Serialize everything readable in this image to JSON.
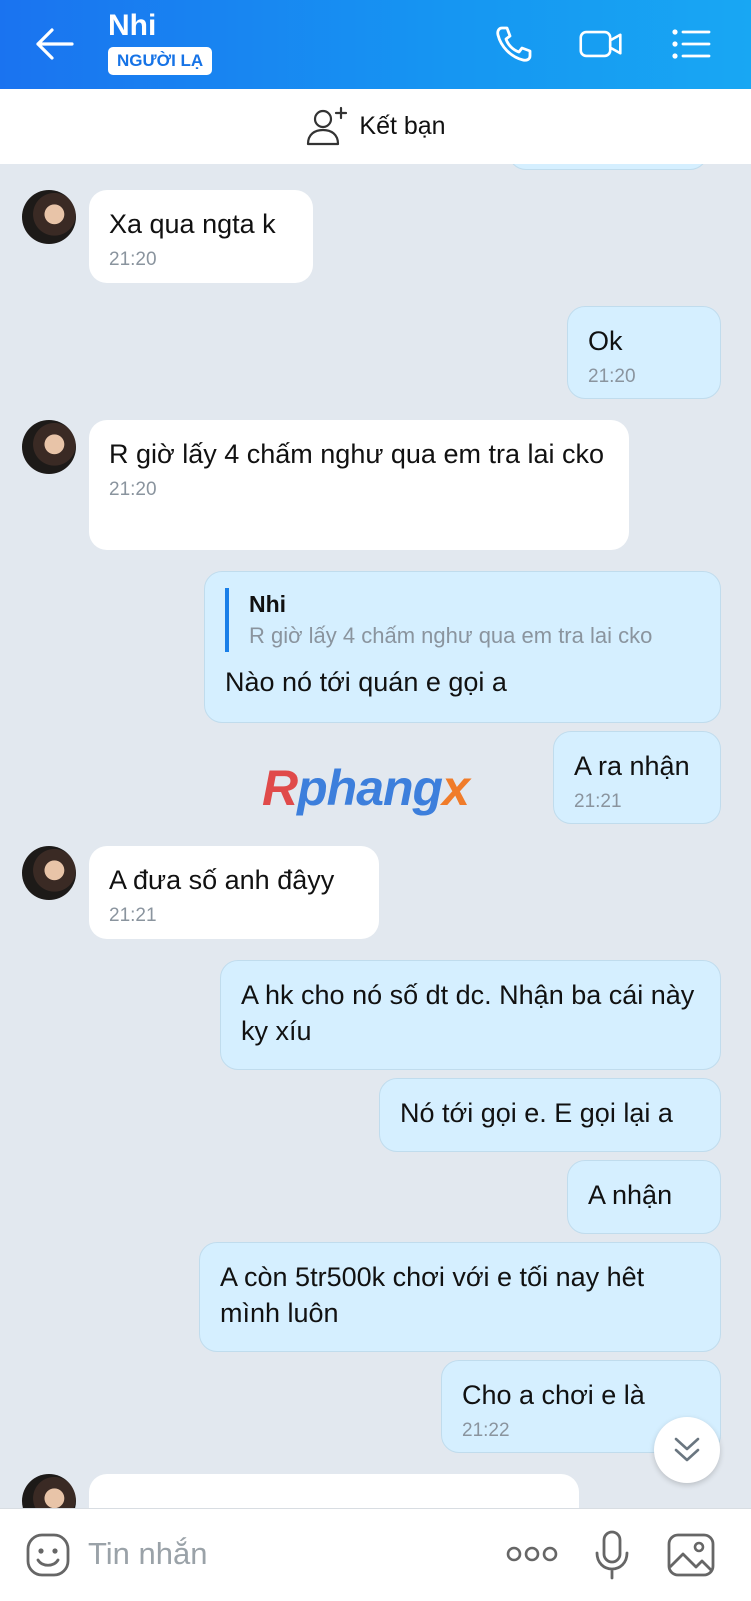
{
  "header": {
    "title": "Nhi",
    "badge": "NGƯỜI LẠ",
    "accent": "#1a73f0"
  },
  "friend_bar": {
    "label": "Kết bạn",
    "icon": "add-friend-icon"
  },
  "messages": [
    {
      "dir": "in",
      "text": "Xa qua ngta k",
      "time": "21:20"
    },
    {
      "dir": "out",
      "text": "Ok",
      "time": "21:20"
    },
    {
      "dir": "in",
      "text": "R giờ lấy 4 chấm nghư qua em tra lai cko",
      "time": "21:20"
    },
    {
      "dir": "out",
      "quote_name": "Nhi",
      "quote_text": "R giờ lấy 4 chấm nghư qua em tra lai cko",
      "text": "Nào nó tới quán e gọi a"
    },
    {
      "dir": "out",
      "text": "A ra nhận",
      "time": "21:21"
    },
    {
      "dir": "in",
      "text": "A đưa số anh đâyy",
      "time": "21:21"
    },
    {
      "dir": "out",
      "text": "A hk cho nó số dt dc. Nhận ba cái này ky xíu"
    },
    {
      "dir": "out",
      "text": "Nó tới gọi e. E gọi lại a"
    },
    {
      "dir": "out",
      "text": "A nhận"
    },
    {
      "dir": "out",
      "text": "A còn 5tr500k chơi với e tối nay hêt mình luôn"
    },
    {
      "dir": "out",
      "text": "Cho a chơi e là",
      "time": "21:22"
    }
  ],
  "watermark": {
    "part1": "R",
    "part2": "phang",
    "part3": "x"
  },
  "input": {
    "placeholder": "Tin nhắn"
  }
}
